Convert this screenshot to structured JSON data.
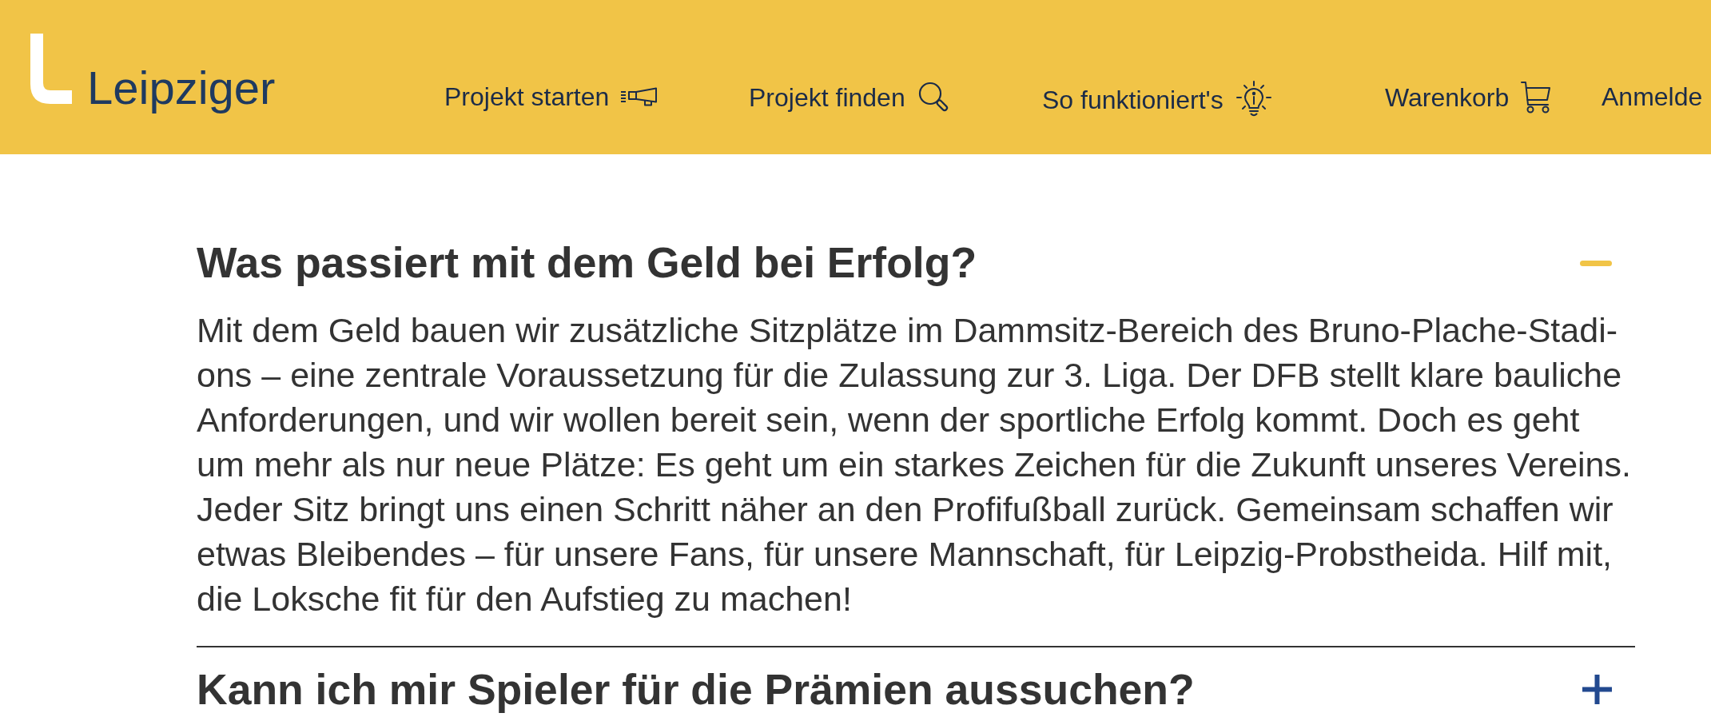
{
  "header": {
    "logo": {
      "text": "Leipziger"
    },
    "nav": [
      {
        "label": "Projekt starten"
      },
      {
        "label": "Projekt finden"
      },
      {
        "label": "So funktioniert's"
      },
      {
        "label": "Warenkorb"
      },
      {
        "label": "Anmelde"
      }
    ]
  },
  "faq": [
    {
      "question": "Was passiert mit dem Geld bei Erfolg?",
      "expanded": true,
      "answer": "Mit dem Geld bauen wir zusätzliche Sitzplätze im Dammsitz-Bereich des Bruno-Plache-Stadi-\nons – eine zentrale Voraussetzung für die Zulassung zur 3. Liga. Der DFB stellt klare bauliche\nAnforderungen, und wir wollen bereit sein, wenn der sportliche Erfolg kommt. Doch es geht\num mehr als nur neue Plätze: Es geht um ein starkes Zeichen für die Zukunft unseres Vereins.\nJeder Sitz bringt uns einen Schritt näher an den Profifußball zurück. Gemeinsam schaffen wir\netwas Bleibendes – für unsere Fans, für unsere Mannschaft, für Leipzig-Probstheida. Hilf mit,\ndie Loksche fit für den Aufstieg zu machen!"
    },
    {
      "question": "Kann ich mir Spieler für die Prämien aussuchen?",
      "expanded": false
    }
  ]
}
